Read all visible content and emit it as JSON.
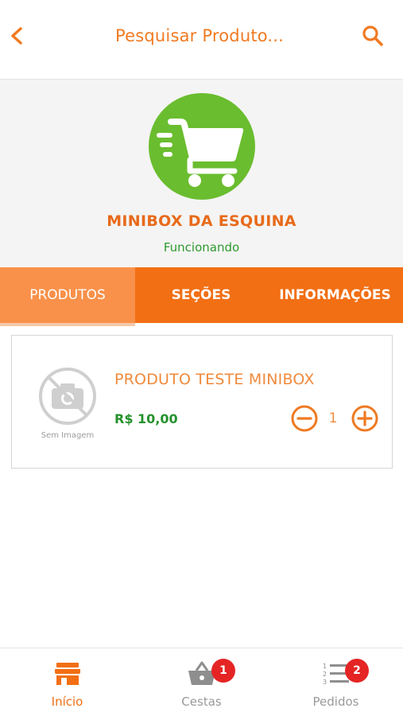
{
  "header": {
    "search_placeholder": "Pesquisar Produto...",
    "back_icon": "chevron-left-icon",
    "search_icon": "search-icon"
  },
  "store": {
    "logo_icon": "shopping-cart-icon",
    "name": "MINIBOX DA ESQUINA",
    "status": "Funcionando"
  },
  "tabs": [
    {
      "label": "PRODUTOS",
      "active": true
    },
    {
      "label": "SEÇÕES",
      "active": false
    },
    {
      "label": "INFORMAÇÕES",
      "active": false
    }
  ],
  "product": {
    "image_label": "Sem Imagem",
    "name": "PRODUTO TESTE MINIBOX",
    "price": "R$ 10,00",
    "quantity": "1"
  },
  "bottom_nav": [
    {
      "label": "Início",
      "icon": "store-icon",
      "active": true
    },
    {
      "label": "Cestas",
      "icon": "basket-icon",
      "badge": "1"
    },
    {
      "label": "Pedidos",
      "icon": "list-icon",
      "badge": "2"
    }
  ],
  "colors": {
    "brand_orange": "#f26f14",
    "logo_green": "#6abd2f",
    "price_green": "#25912c",
    "badge_red": "#e52424"
  }
}
